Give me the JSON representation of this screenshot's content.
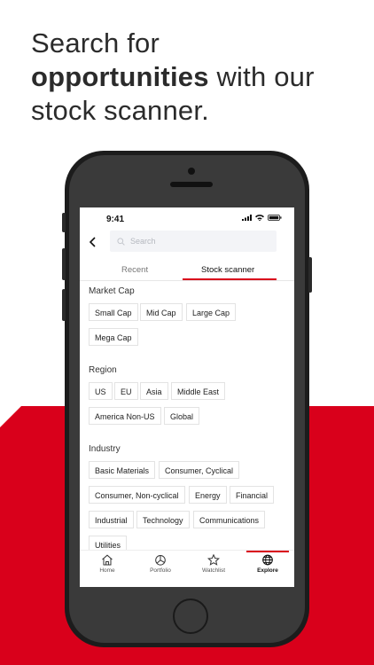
{
  "headline": {
    "line1": "Search for",
    "bold": "opportunities",
    "rest": " with our",
    "line3": "stock scanner."
  },
  "status": {
    "time": "9:41"
  },
  "search": {
    "placeholder": "Search"
  },
  "tabs": {
    "recent": "Recent",
    "scanner": "Stock scanner"
  },
  "sections": {
    "market_cap": {
      "title": "Market Cap",
      "chips": [
        "Small Cap",
        "Mid Cap",
        "Large Cap",
        "Mega Cap"
      ]
    },
    "region": {
      "title": "Region",
      "chips": [
        "US",
        "EU",
        "Asia",
        "Middle East",
        "America Non-US",
        "Global"
      ]
    },
    "industry": {
      "title": "Industry",
      "chips": [
        "Basic Materials",
        "Consumer, Cyclical",
        "Consumer, Non-cyclical",
        "Energy",
        "Financial",
        "Industrial",
        "Technology",
        "Communications",
        "Utilities"
      ]
    }
  },
  "nav": {
    "home": "Home",
    "portfolio": "Portfolio",
    "watchlist": "Watchlist",
    "explore": "Explore"
  },
  "colors": {
    "accent": "#d9001b"
  }
}
